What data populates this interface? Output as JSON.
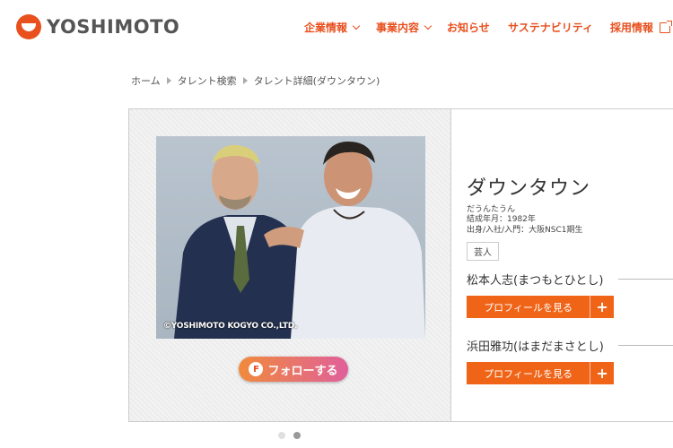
{
  "header": {
    "logo_text": "YOSHIMOTO",
    "nav": [
      {
        "label": "企業情報",
        "icon": "chevron-down-icon"
      },
      {
        "label": "事業内容",
        "icon": "chevron-down-icon"
      },
      {
        "label": "お知らせ"
      },
      {
        "label": "サステナビリティ"
      },
      {
        "label": "採用情報",
        "icon": "external-link-icon"
      }
    ]
  },
  "breadcrumb": [
    "ホーム",
    "タレント検索",
    "タレント詳細(ダウンタウン)"
  ],
  "talent": {
    "photo_copyright": "©YOSHIMOTO KOGYO CO.,LTD.",
    "follow_label": "フォローする",
    "follow_icon_letter": "F",
    "name": "ダウンタウン",
    "reading": "だうんたうん",
    "formed": "結成年月：1982年",
    "origin": "出身/入社/入門：大阪NSC1期生",
    "tag": "芸人",
    "members": [
      {
        "name": "松本人志(まつもとひとし)",
        "button": "プロフィールを見る"
      },
      {
        "name": "浜田雅功(はまだまさとし)",
        "button": "プロフィールを見る"
      }
    ]
  },
  "carousel": {
    "count": 2,
    "active_index": 1
  },
  "colors": {
    "accent": "#e8501e",
    "button": "#f06418",
    "dot_inactive": "#e0e0e0",
    "dot_active": "#999999"
  }
}
